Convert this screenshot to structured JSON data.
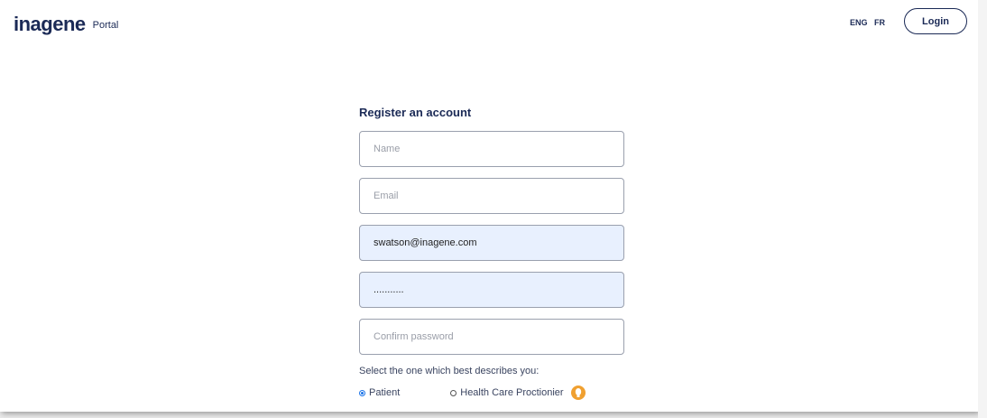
{
  "header": {
    "logo_text": "inagene",
    "portal_label": "Portal",
    "lang_eng": "ENG",
    "lang_fr": "FR",
    "login_label": "Login"
  },
  "form": {
    "title": "Register an account",
    "name_placeholder": "Name",
    "email_placeholder": "Email",
    "username_value": "swatson@inagene.com",
    "password_value": "...........",
    "confirm_placeholder": "Confirm password",
    "describe_label": "Select the one which best describes you:",
    "options": [
      {
        "label": "Patient",
        "checked": true
      },
      {
        "label": "Health Care Proctionier",
        "checked": false
      }
    ],
    "info_icon": "info-icon"
  },
  "colors": {
    "brand": "#1b2a56",
    "autofill": "#e8f0fe",
    "info": "#f0a030"
  }
}
